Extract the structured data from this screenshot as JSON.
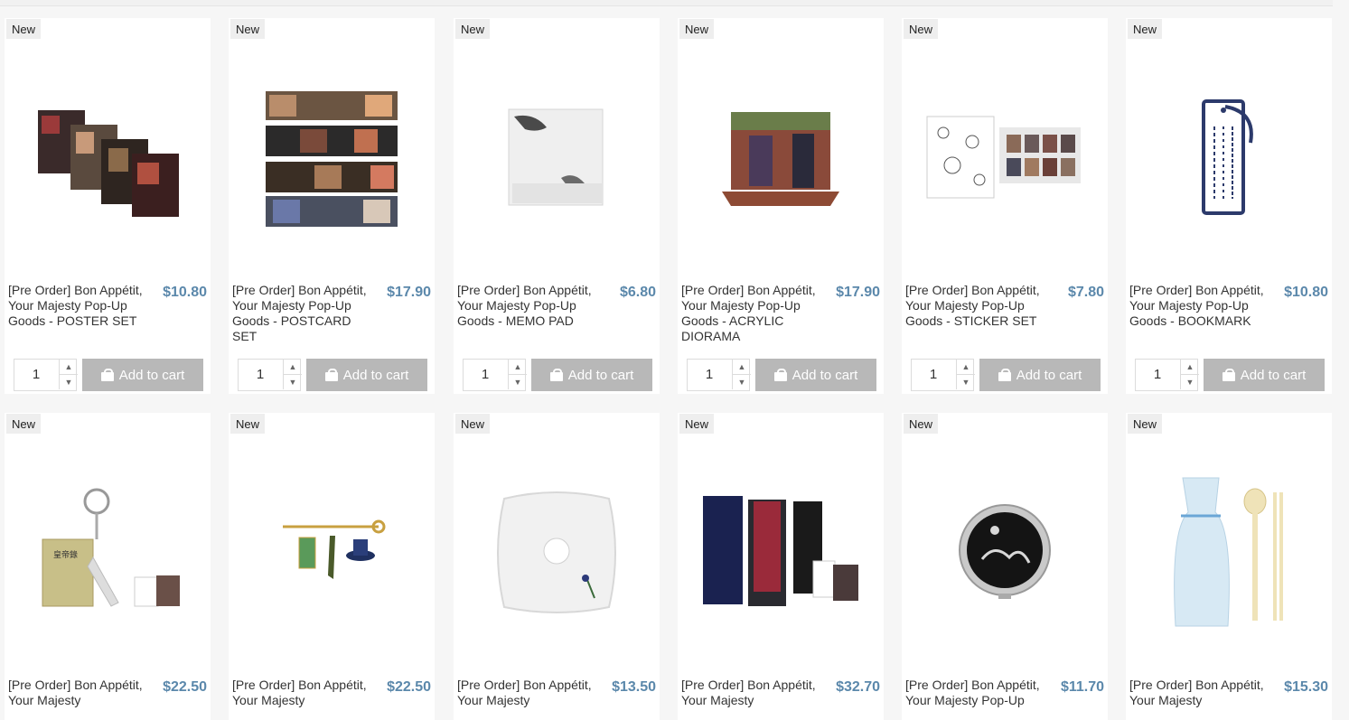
{
  "badge_label": "New",
  "qty_default": "1",
  "add_to_cart_label": "Add to cart",
  "products": [
    {
      "name": "[Pre Order] Bon Appétit, Your Majesty Pop-Up Goods - POSTER SET",
      "price": "$10.80",
      "image": "poster-set-image"
    },
    {
      "name": "[Pre Order] Bon Appétit, Your Majesty Pop-Up Goods - POSTCARD SET",
      "price": "$17.90",
      "image": "postcard-set-image"
    },
    {
      "name": "[Pre Order] Bon Appétit, Your Majesty Pop-Up Goods - MEMO PAD",
      "price": "$6.80",
      "image": "memo-pad-image"
    },
    {
      "name": "[Pre Order] Bon Appétit, Your Majesty Pop-Up Goods - ACRYLIC DIORAMA",
      "price": "$17.90",
      "image": "acrylic-diorama-image"
    },
    {
      "name": "[Pre Order] Bon Appétit, Your Majesty Pop-Up Goods - STICKER SET",
      "price": "$7.80",
      "image": "sticker-set-image"
    },
    {
      "name": "[Pre Order] Bon Appétit, Your Majesty Pop-Up Goods - BOOKMARK",
      "price": "$10.80",
      "image": "bookmark-image"
    },
    {
      "name": "[Pre Order] Bon Appétit, Your Majesty",
      "price": "$22.50",
      "image": "keyring-image"
    },
    {
      "name": "[Pre Order] Bon Appétit, Your Majesty",
      "price": "$22.50",
      "image": "brooch-image"
    },
    {
      "name": "[Pre Order] Bon Appétit, Your Majesty",
      "price": "$13.50",
      "image": "scrunchie-image"
    },
    {
      "name": "[Pre Order] Bon Appétit, Your Majesty",
      "price": "$32.70",
      "image": "pen-case-image"
    },
    {
      "name": "[Pre Order] Bon Appétit, Your Majesty Pop-Up",
      "price": "$11.70",
      "image": "hand-mirror-image"
    },
    {
      "name": "[Pre Order] Bon Appétit, Your Majesty",
      "price": "$15.30",
      "image": "cutlery-set-image"
    }
  ]
}
